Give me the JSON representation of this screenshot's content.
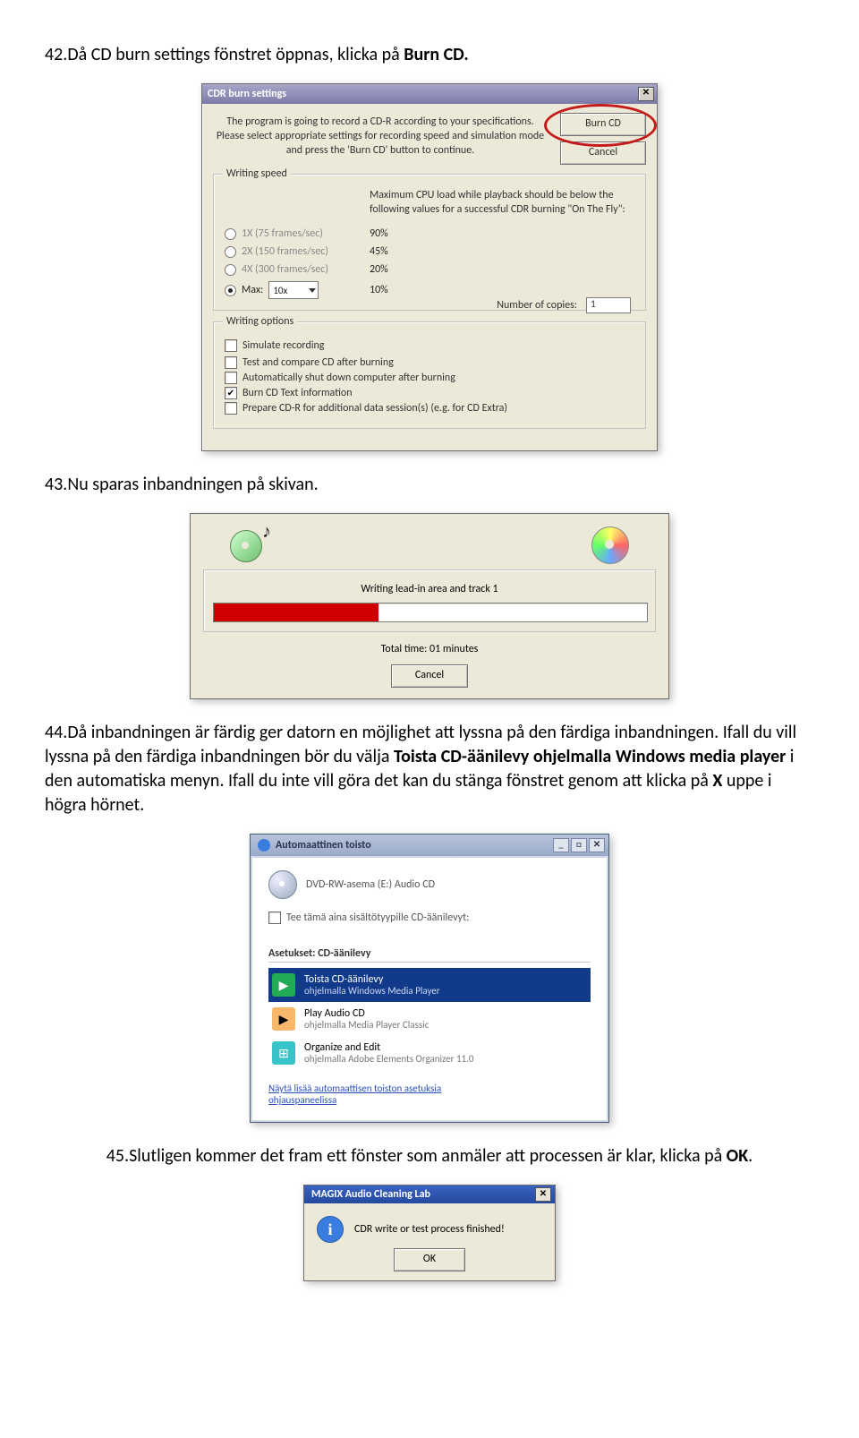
{
  "step42": "42.Då CD burn settings fönstret öppnas, klicka på ",
  "step42_bold": "Burn CD.",
  "dlg1": {
    "title": "CDR burn settings",
    "intro": "The program is going to record a CD-R according to your specifications. Please select appropriate settings for recording speed and simulation mode and press the 'Burn CD' button to continue.",
    "burn_btn": "Burn CD",
    "cancel_btn": "Cancel",
    "ws_legend": "Writing speed",
    "ws_note": "Maximum CPU load while playback should be below the following values for a successful CDR burning \"On The Fly\":",
    "r1": "1X (75 frames/sec)",
    "r2": "2X (150 frames/sec)",
    "r3": "4X (300 frames/sec)",
    "r4": "Max:",
    "combo": "10x",
    "p1": "90%",
    "p2": "45%",
    "p3": "20%",
    "p4": "10%",
    "wo_legend": "Writing options",
    "o1": "Simulate recording",
    "o2": "Test and compare CD after burning",
    "o3": "Automatically shut down computer after burning",
    "o4": "Burn CD Text information",
    "o5": "Prepare CD-R for additional data session(s) (e.g. for CD Extra)",
    "copies_lbl": "Number of copies:",
    "copies_val": "1"
  },
  "step43": "43.Nu sparas inbandningen på skivan.",
  "prog": {
    "track": "Writing lead-in area and track 1",
    "total": "Total time: 01 minutes",
    "cancel": "Cancel"
  },
  "step44_a": "44.Då inbandningen är färdig ger datorn en möjlighet att lyssna på den färdiga inbandningen. Ifall du vill lyssna på den färdiga inbandningen bör du välja ",
  "step44_bold": "Toista CD-äänilevy ohjelmalla Windows media player",
  "step44_b": " i den automatiska menyn. Ifall du inte vill göra det kan du stänga fönstret genom att klicka på ",
  "step44_bold2": "X",
  "step44_c": " uppe i högra hörnet.",
  "autoplay": {
    "title": "Automaattinen toisto",
    "device": "DVD-RW-asema (E:) Audio CD",
    "always": "Tee tämä aina sisältötyypille CD-äänilevyt:",
    "asetukset": "Asetukset: CD-äänilevy",
    "item1_t1": "Toista CD-äänilevy",
    "item1_t2": "ohjelmalla Windows Media Player",
    "item2_t1": "Play Audio CD",
    "item2_t2": "ohjelmalla Media Player Classic",
    "item3_t1": "Organize and Edit",
    "item3_t2": "ohjelmalla Adobe Elements Organizer 11.0",
    "link1": "Näytä lisää automaattisen toiston asetuksia",
    "link2": "ohjauspaneelissa"
  },
  "step45_a": "45.Slutligen kommer det fram ett fönster som anmäler att processen är klar, klicka på ",
  "step45_bold": "OK",
  "step45_b": ".",
  "msg": {
    "title": "MAGIX Audio Cleaning Lab",
    "text": "CDR write or test process finished!",
    "ok": "OK"
  }
}
